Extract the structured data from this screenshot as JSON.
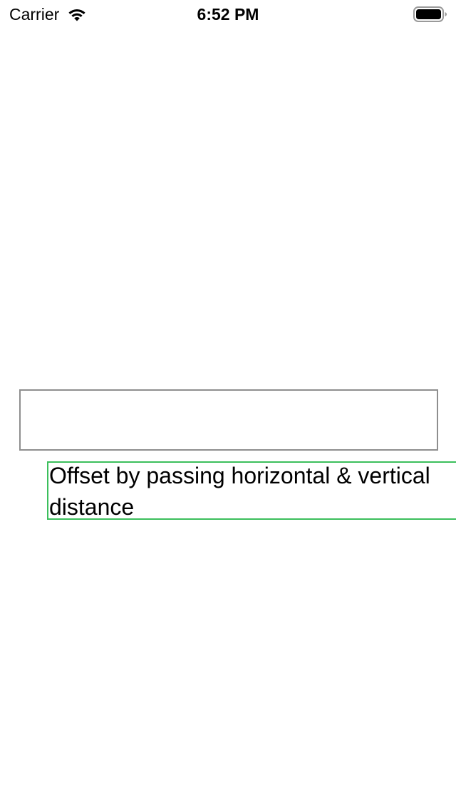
{
  "status_bar": {
    "carrier": "Carrier",
    "time": "6:52 PM",
    "icons": [
      "wifi-icon",
      "battery-icon"
    ]
  },
  "content": {
    "label_text": "Offset by passing horizontal & vertical distance"
  },
  "colors": {
    "box_border": "#8e8e8e",
    "label_border": "#3bbf5c"
  }
}
